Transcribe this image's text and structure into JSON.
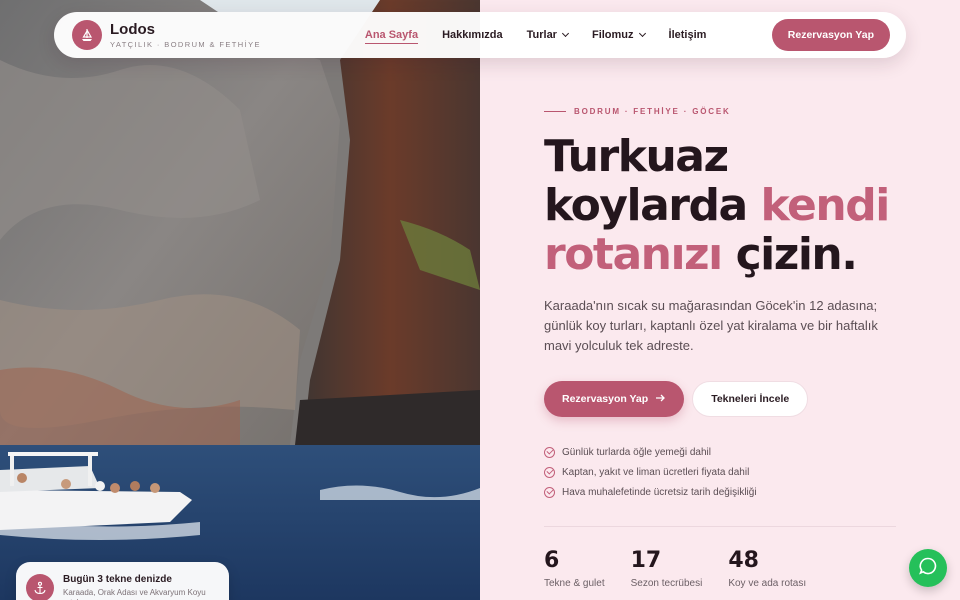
{
  "brand": {
    "title": "Lodos",
    "subtitle": "YATÇILIK · BODRUM & FETHİYE",
    "logo_icon": "sailboat-icon"
  },
  "nav": {
    "items": [
      {
        "label": "Ana Sayfa",
        "active": true
      },
      {
        "label": "Hakkımızda",
        "active": false
      },
      {
        "label": "Turlar",
        "active": false,
        "dropdown": true
      },
      {
        "label": "Filomuz",
        "active": false,
        "dropdown": true
      },
      {
        "label": "İletişim",
        "active": false
      }
    ],
    "cta_label": "Rezervasyon Yap"
  },
  "hero": {
    "eyebrow": "BODRUM · FETHİYE · GÖCEK",
    "headline_part1": "Turkuaz koylarda ",
    "headline_accent": "kendi rotanızı",
    "headline_part2": " çizin.",
    "lead": "Karaada'nın sıcak su mağarasından Göcek'in 12 adasına; günlük koy turları, kaptanlı özel yat kiralama ve bir haftalık mavi yolculuk tek adreste.",
    "primary_button": "Rezervasyon Yap",
    "secondary_button": "Tekneleri İncele",
    "features": [
      "Günlük turlarda öğle yemeği dahil",
      "Kaptan, yakıt ve liman ücretleri fiyata dahil",
      "Hava muhalefetinde ücretsiz tarih değişikliği"
    ],
    "stats": [
      {
        "value": "6",
        "label": "Tekne & gulet"
      },
      {
        "value": "17",
        "label": "Sezon tecrübesi"
      },
      {
        "value": "48",
        "label": "Koy ve ada rotası"
      }
    ]
  },
  "status_card": {
    "title": "Bugün 3 tekne denizde",
    "subtitle": "Karaada, Orak Adası ve Akvaryum Koyu rotaları",
    "icon": "anchor-icon"
  },
  "colors": {
    "accent": "#b9566f",
    "background": "#fbe9ee",
    "whatsapp": "#25c05a"
  },
  "whatsapp_icon": "whatsapp-icon"
}
